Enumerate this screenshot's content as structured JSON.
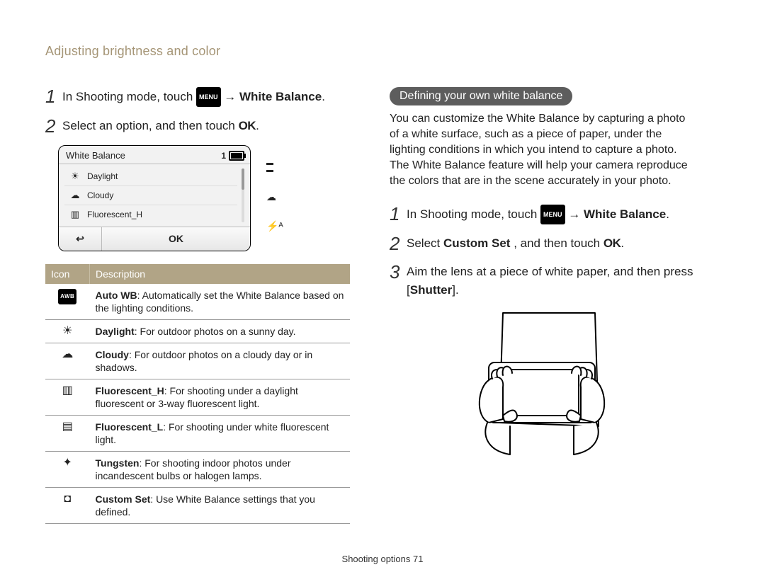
{
  "breadcrumb": "Adjusting brightness and color",
  "left": {
    "step1_pre": "In Shooting mode, touch ",
    "step1_menu": "MENU",
    "step1_post": " → ",
    "step1_target": "White Balance",
    "step1_end": ".",
    "step2_pre": "Select an option, and then touch ",
    "step2_ok": "OK",
    "step2_end": "."
  },
  "lcd": {
    "title": "White Balance",
    "count": "1",
    "items": [
      {
        "icon": "☀",
        "label": "Daylight"
      },
      {
        "icon": "☁",
        "label": "Cloudy"
      },
      {
        "icon": "▥",
        "label": "Fluorescent_H"
      }
    ],
    "back": "↩",
    "ok": "OK",
    "side_cloud": "☁",
    "side_flash": "⚡ᴬ"
  },
  "table": {
    "head_icon": "Icon",
    "head_desc": "Description",
    "rows": [
      {
        "icon_html": "AWB",
        "icon_kind": "awb",
        "key": "Auto WB",
        "desc": ": Automatically set the White Balance based on the lighting conditions."
      },
      {
        "icon_html": "☀",
        "icon_kind": "sun",
        "key": "Daylight",
        "desc": ": For outdoor photos on a sunny day."
      },
      {
        "icon_html": "☁",
        "icon_kind": "cloud",
        "key": "Cloudy",
        "desc": ": For outdoor photos on a cloudy day or in shadows."
      },
      {
        "icon_html": "▥",
        "icon_kind": "fluoh",
        "key": "Fluorescent_H",
        "desc": ": For shooting under a daylight fluorescent or 3-way fluorescent light."
      },
      {
        "icon_html": "▤",
        "icon_kind": "fluol",
        "key": "Fluorescent_L",
        "desc": ": For shooting under white fluorescent light."
      },
      {
        "icon_html": "✦",
        "icon_kind": "tung",
        "key": "Tungsten",
        "desc": ": For shooting indoor photos under incandescent bulbs or halogen lamps."
      },
      {
        "icon_html": "◘",
        "icon_kind": "custom",
        "key": "Custom Set",
        "desc": ": Use White Balance settings that you defined."
      }
    ]
  },
  "right": {
    "pill": "Defining your own white balance",
    "para": "You can customize the White Balance by capturing a photo of a white surface, such as a piece of paper, under the lighting conditions in which you intend to capture a photo. The White Balance feature will help your camera reproduce the colors that are in the scene accurately in your photo.",
    "step1_pre": "In Shooting mode, touch ",
    "step1_menu": "MENU",
    "step1_post": " → ",
    "step1_target": "White Balance",
    "step1_end": ".",
    "step2_pre": "Select ",
    "step2_key": "Custom Set",
    "step2_mid": ", and then touch ",
    "step2_ok": "OK",
    "step2_end": ".",
    "step3_pre": "Aim the lens at a piece of white paper, and then press [",
    "step3_key": "Shutter",
    "step3_end": "]."
  },
  "footer": {
    "section": "Shooting options ",
    "page": "71"
  }
}
